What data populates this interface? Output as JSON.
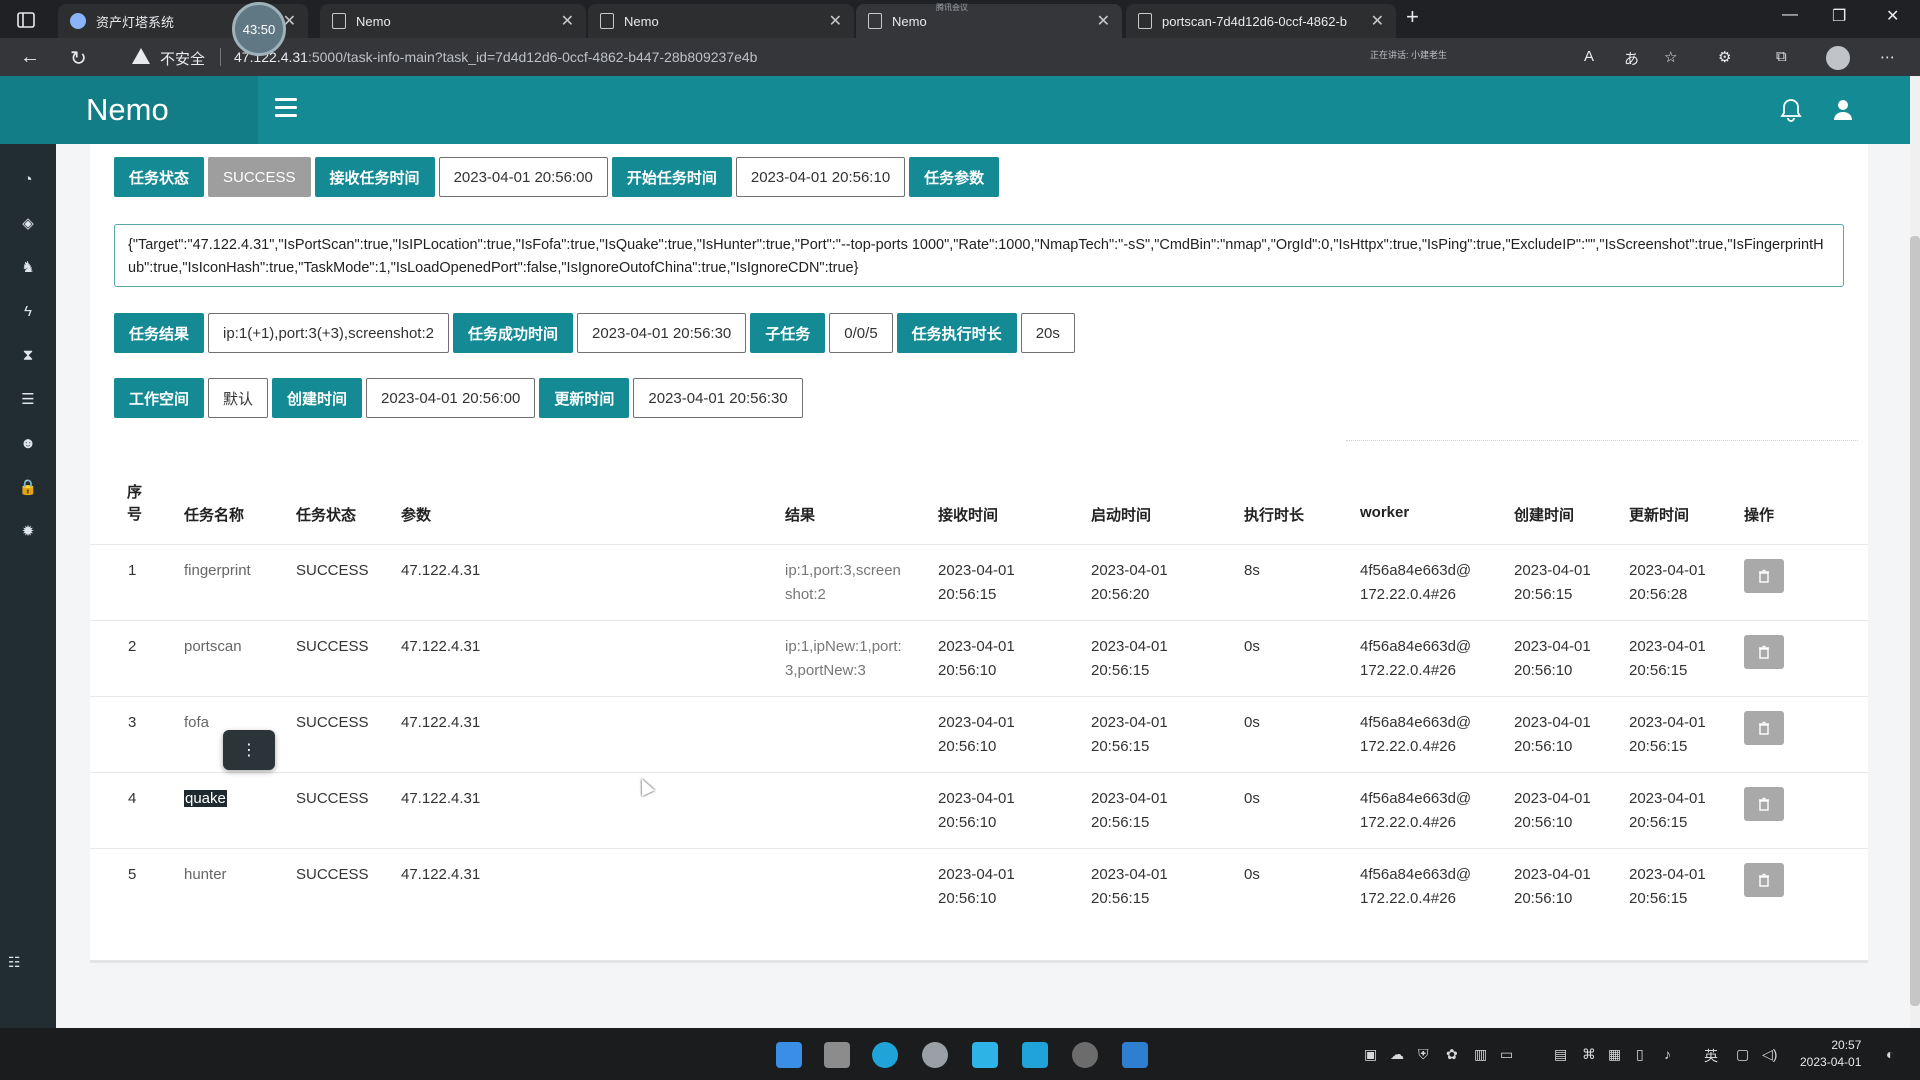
{
  "browser": {
    "tabs": [
      {
        "title": "资产灯塔系统"
      },
      {
        "title": "Nemo"
      },
      {
        "title": "Nemo"
      },
      {
        "title": "Nemo"
      },
      {
        "title": "portscan-7d4d12d6-0ccf-4862-b"
      }
    ],
    "timer": "43:50",
    "meeting_label": "腾讯会议",
    "insecure_label": "不安全",
    "url_host": "47.122.4.31",
    "url_rest": ":5000/task-info-main?task_id=7d4d12d6-0ccf-4862-b447-28b809237e4b",
    "speaking_label": "正在讲话: 小建老生"
  },
  "app": {
    "brand": "Nemo"
  },
  "task_info": {
    "row1": {
      "status_label": "任务状态",
      "status_value": "SUCCESS",
      "received_label": "接收任务时间",
      "received_value": "2023-04-01 20:56:00",
      "started_label": "开始任务时间",
      "started_value": "2023-04-01 20:56:10",
      "params_label": "任务参数"
    },
    "params_json": "{\"Target\":\"47.122.4.31\",\"IsPortScan\":true,\"IsIPLocation\":true,\"IsFofa\":true,\"IsQuake\":true,\"IsHunter\":true,\"Port\":\"--top-ports 1000\",\"Rate\":1000,\"NmapTech\":\"-sS\",\"CmdBin\":\"nmap\",\"OrgId\":0,\"IsHttpx\":true,\"IsPing\":true,\"ExcludeIP\":\"\",\"IsScreenshot\":true,\"IsFingerprintHub\":true,\"IsIconHash\":true,\"TaskMode\":1,\"IsLoadOpenedPort\":false,\"IsIgnoreOutofChina\":true,\"IsIgnoreCDN\":true}",
    "row2": {
      "result_label": "任务结果",
      "result_value": "ip:1(+1),port:3(+3),screenshot:2",
      "success_time_label": "任务成功时间",
      "success_time_value": "2023-04-01 20:56:30",
      "subtask_label": "子任务",
      "subtask_value": "0/0/5",
      "duration_label": "任务执行时长",
      "duration_value": "20s"
    },
    "row3": {
      "workspace_label": "工作空间",
      "workspace_value": "默认",
      "created_label": "创建时间",
      "created_value": "2023-04-01 20:56:00",
      "updated_label": "更新时间",
      "updated_value": "2023-04-01 20:56:30"
    }
  },
  "subtasks": {
    "columns": [
      "序号",
      "任务名称",
      "任务状态",
      "参数",
      "结果",
      "接收时间",
      "启动时间",
      "执行时长",
      "worker",
      "创建时间",
      "更新时间",
      "操作"
    ],
    "rows": [
      {
        "no": "1",
        "name": "fingerprint",
        "status": "SUCCESS",
        "args": "47.122.4.31",
        "result": "ip:1,port:3,screen\nshot:2",
        "received": "2023-04-01\n20:56:15",
        "started": "2023-04-01\n20:56:20",
        "duration": "8s",
        "worker": "4f56a84e663d@\n172.22.0.4#26",
        "created": "2023-04-01\n20:56:15",
        "updated": "2023-04-01\n20:56:28"
      },
      {
        "no": "2",
        "name": "portscan",
        "status": "SUCCESS",
        "args": "47.122.4.31",
        "result": "ip:1,ipNew:1,port:\n3,portNew:3",
        "received": "2023-04-01\n20:56:10",
        "started": "2023-04-01\n20:56:15",
        "duration": "0s",
        "worker": "4f56a84e663d@\n172.22.0.4#26",
        "created": "2023-04-01\n20:56:10",
        "updated": "2023-04-01\n20:56:15"
      },
      {
        "no": "3",
        "name": "fofa",
        "status": "SUCCESS",
        "args": "47.122.4.31",
        "result": "",
        "received": "2023-04-01\n20:56:10",
        "started": "2023-04-01\n20:56:15",
        "duration": "0s",
        "worker": "4f56a84e663d@\n172.22.0.4#26",
        "created": "2023-04-01\n20:56:10",
        "updated": "2023-04-01\n20:56:15"
      },
      {
        "no": "4",
        "name": "quake",
        "status": "SUCCESS",
        "args": "47.122.4.31",
        "result": "",
        "received": "2023-04-01\n20:56:10",
        "started": "2023-04-01\n20:56:15",
        "duration": "0s",
        "worker": "4f56a84e663d@\n172.22.0.4#26",
        "created": "2023-04-01\n20:56:10",
        "updated": "2023-04-01\n20:56:15"
      },
      {
        "no": "5",
        "name": "hunter",
        "status": "SUCCESS",
        "args": "47.122.4.31",
        "result": "",
        "received": "2023-04-01\n20:56:10",
        "started": "2023-04-01\n20:56:15",
        "duration": "0s",
        "worker": "4f56a84e663d@\n172.22.0.4#26",
        "created": "2023-04-01\n20:56:10",
        "updated": "2023-04-01\n20:56:15"
      }
    ]
  },
  "taskbar": {
    "ime": "英",
    "time": "20:57",
    "date": "2023-04-01"
  },
  "colors": {
    "accent": "#148a94",
    "sidebar": "#222d32",
    "status_success_bg": "#9e9e9e"
  }
}
